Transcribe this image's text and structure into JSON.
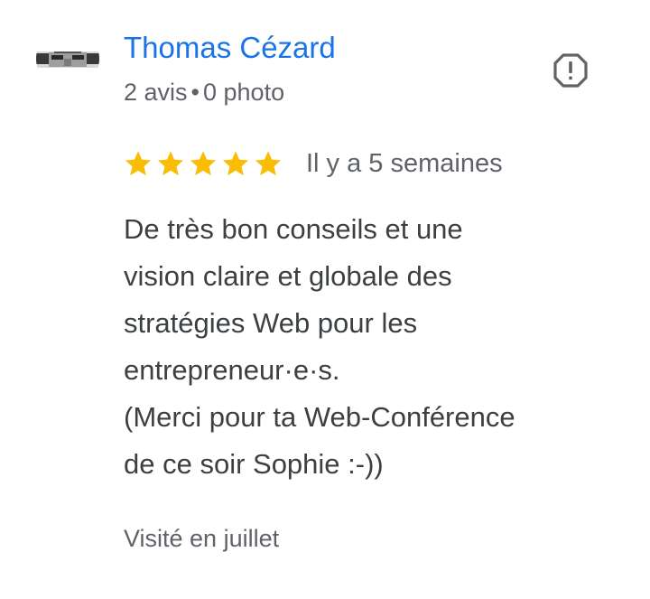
{
  "author": {
    "name": "Thomas Cézard",
    "reviews_count": "2 avis",
    "separator": "•",
    "photos_count": "0 photo"
  },
  "icons": {
    "avatar": "user-avatar-photo",
    "report": "report-alert-icon",
    "star": "star-icon"
  },
  "rating": {
    "stars": 5,
    "max": 5,
    "star_color": "#fbbc04"
  },
  "review": {
    "date": "Il y a 5 semaines",
    "lines": [
      "De très bon conseils et une",
      "vision claire et globale des",
      "stratégies Web pour les",
      "entrepreneur·e·s.",
      "(Merci pour ta Web-Conférence",
      "de ce soir Sophie :-))"
    ],
    "visited": "Visité en juillet"
  },
  "colors": {
    "name_link": "#1a73e8",
    "secondary_text": "#5f6368",
    "body_text": "#3c4043"
  }
}
